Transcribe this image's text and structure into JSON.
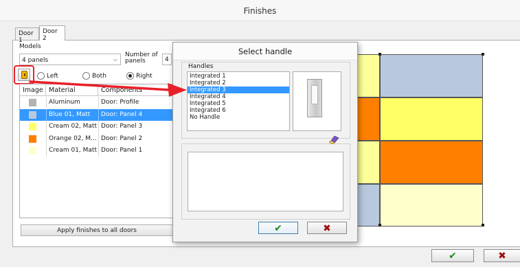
{
  "window": {
    "title": "Finishes"
  },
  "tabs": [
    {
      "label": "Door 1"
    },
    {
      "label": "Door 2"
    }
  ],
  "models": {
    "label": "Models",
    "selected": "4 panels",
    "panels_label": "Number of panels",
    "panels_value": "4"
  },
  "hinge": {
    "icon": "hinge-icon",
    "options": [
      {
        "label": "Left",
        "selected": false
      },
      {
        "label": "Both",
        "selected": false
      },
      {
        "label": "Right",
        "selected": true
      }
    ]
  },
  "table": {
    "columns": [
      "Image",
      "Material",
      "Components"
    ],
    "rows": [
      {
        "material": "Aluminum",
        "component": "Door: Profile",
        "color": "#b3b3b3",
        "selected": false
      },
      {
        "material": "Blue 01, Matt",
        "component": "Door: Panel 4",
        "color": "#b8c8df",
        "selected": true
      },
      {
        "material": "Cream 02, Matt",
        "component": "Door: Panel 3",
        "color": "#ffff66",
        "selected": false
      },
      {
        "material": "Orange 02, M...",
        "component": "Door: Panel 2",
        "color": "#ff8000",
        "selected": false
      },
      {
        "material": "Cream 01, Matt",
        "component": "Door: Panel 1",
        "color": "#ffffcc",
        "selected": false
      }
    ]
  },
  "apply_button": "Apply finishes to all doors",
  "preview": {
    "colors": {
      "blue": "#b8c8df",
      "cream2": "#ffff66",
      "orange": "#ff8000",
      "cream1": "#ffffcc",
      "left_cream": "#ffff99"
    }
  },
  "dialog": {
    "title": "Select handle",
    "group_label": "Handles",
    "items": [
      "Integrated 1",
      "Integrated 2",
      "Integrated 3",
      "Integrated 4",
      "Integrated 5",
      "Integrated 6",
      "No Handle"
    ],
    "selected_index": 2,
    "eraser_icon": "eraser-icon",
    "notes_value": ""
  },
  "buttons": {
    "ok_icon": "check-icon",
    "cancel_icon": "close-icon"
  },
  "colors": {
    "accent": "#3399ff",
    "annotation_red": "#e8202a"
  }
}
